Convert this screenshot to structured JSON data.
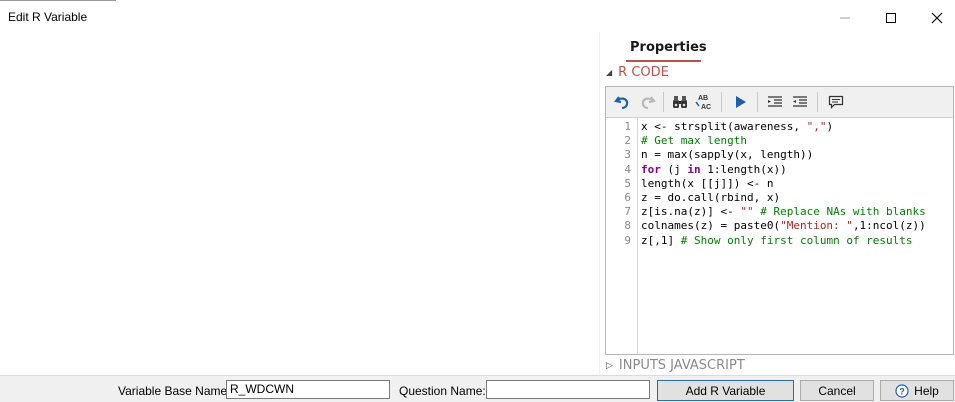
{
  "window": {
    "title": "Edit R Variable"
  },
  "properties_panel": {
    "tab_label": "Properties",
    "rcode_section": "R CODE",
    "inputs_section": "INPUTS JAVASCRIPT"
  },
  "toolbar_icons": [
    "undo-icon",
    "redo-icon",
    "find-icon",
    "spellcheck-icon",
    "run-icon",
    "indent-icon",
    "outdent-icon",
    "comment-icon"
  ],
  "code_lines": [
    {
      "num": "1",
      "segments": [
        {
          "t": "x <- strsplit(awareness, ",
          "c": ""
        },
        {
          "t": "\",\"",
          "c": "str"
        },
        {
          "t": ")",
          "c": ""
        }
      ]
    },
    {
      "num": "2",
      "segments": [
        {
          "t": "# Get max length",
          "c": "cm"
        }
      ]
    },
    {
      "num": "3",
      "segments": [
        {
          "t": "n = max(sapply(x, length))",
          "c": ""
        }
      ]
    },
    {
      "num": "4",
      "segments": [
        {
          "t": "for",
          "c": "kw"
        },
        {
          "t": " (j ",
          "c": ""
        },
        {
          "t": "in",
          "c": "kw"
        },
        {
          "t": " 1:length(x))",
          "c": ""
        }
      ]
    },
    {
      "num": "5",
      "segments": [
        {
          "t": "length(x [[j]]) <- n",
          "c": ""
        }
      ]
    },
    {
      "num": "6",
      "segments": [
        {
          "t": "z = do.call(rbind, x)",
          "c": ""
        }
      ]
    },
    {
      "num": "7",
      "segments": [
        {
          "t": "z[is.na(z)] <- ",
          "c": ""
        },
        {
          "t": "\"\"",
          "c": "str"
        },
        {
          "t": " # Replace NAs with blanks",
          "c": "cm"
        }
      ]
    },
    {
      "num": "8",
      "segments": [
        {
          "t": "colnames(z) = paste0(",
          "c": ""
        },
        {
          "t": "\"Mention: \"",
          "c": "str"
        },
        {
          "t": ",1:ncol(z))",
          "c": ""
        }
      ]
    },
    {
      "num": "9",
      "segments": [
        {
          "t": "z[,1] ",
          "c": ""
        },
        {
          "t": "# Show only first column of results",
          "c": "cm"
        }
      ]
    }
  ],
  "footer": {
    "base_name_label": "Variable Base Name:",
    "base_name_value": "R_WDCWN",
    "question_name_label": "Question Name:",
    "question_name_value": "",
    "add_button": "Add R Variable",
    "cancel_button": "Cancel",
    "help_button": "Help"
  }
}
